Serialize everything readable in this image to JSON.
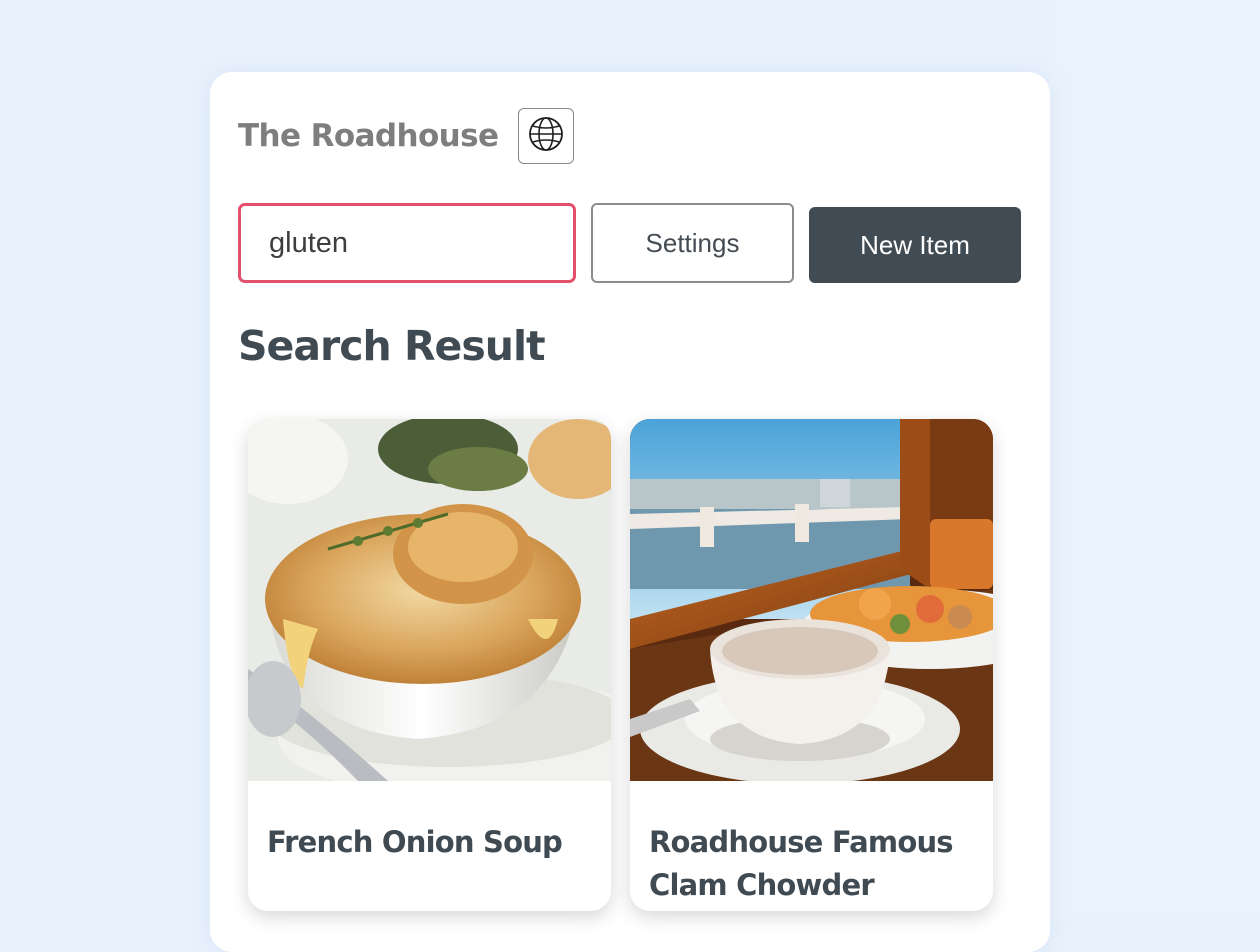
{
  "header": {
    "restaurant_name": "The Roadhouse",
    "language_icon": "globe-icon"
  },
  "toolbar": {
    "search_value": "gluten",
    "settings_label": "Settings",
    "new_item_label": "New Item"
  },
  "results": {
    "heading": "Search Result",
    "items": [
      {
        "name": "French Onion Soup",
        "image_icon": "soup-bowl-photo"
      },
      {
        "name": "Roadhouse Famous Clam Chowder",
        "image_icon": "chowder-cup-photo"
      }
    ]
  },
  "colors": {
    "page_background": "#e8f2fd",
    "panel_background": "#ffffff",
    "search_focus_border": "#e4506b",
    "primary_button": "#414b53",
    "heading_text": "#3f4a52",
    "brand_text": "#7e7e7e"
  }
}
